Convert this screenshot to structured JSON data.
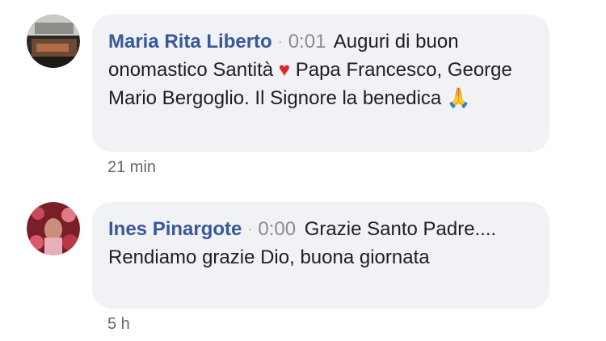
{
  "comments": [
    {
      "author": "Maria Rita Liberto",
      "separator": "·",
      "timestamp_link": "0:01",
      "text_1": "Auguri di buon onomastico Santità",
      "emoji_1": "♥",
      "text_2": "Papa Francesco, George Mario Bergoglio. Il Signore la benedica",
      "emoji_2": "🙏",
      "age": "21 min"
    },
    {
      "author": "Ines Pinargote",
      "separator": "·",
      "timestamp_link": "0:00",
      "text_1": "Grazie Santo Padre.... Rendiamo grazie Dio, buona giornata",
      "age": "5 h"
    }
  ],
  "colors": {
    "bubble_bg": "#f0f2f5",
    "author": "#385898",
    "timestamp": "#8a8d91",
    "meta": "#65676b"
  }
}
